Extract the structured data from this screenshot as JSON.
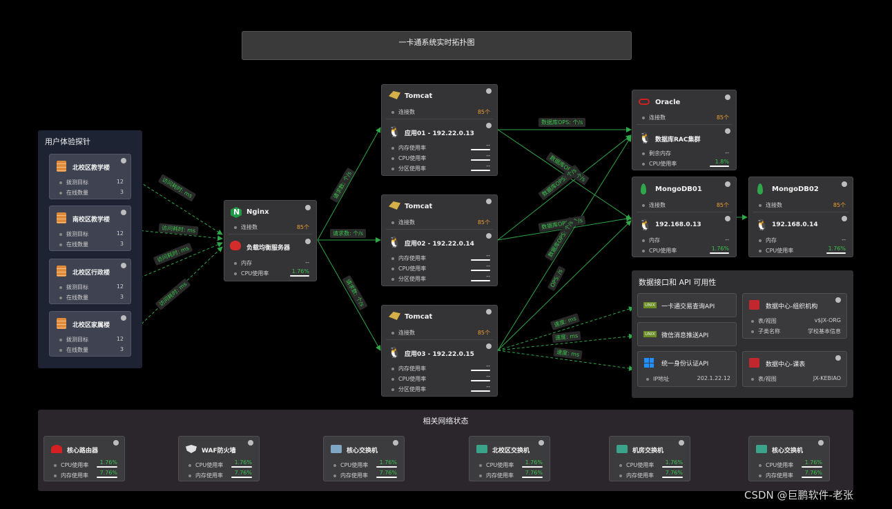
{
  "title": "一卡通系统实时拓扑图",
  "probe": {
    "heading": "用户体验探针",
    "items": [
      {
        "name": "北校区教学楼",
        "k1": "拨测目标",
        "v1": "12",
        "k2": "在线数量",
        "v2": "3"
      },
      {
        "name": "南校区教学楼",
        "k1": "拨测目标",
        "v1": "12",
        "k2": "在线数量",
        "v2": "3"
      },
      {
        "name": "北校区行政楼",
        "k1": "拨测目标",
        "v1": "12",
        "k2": "在线数量",
        "v2": "3"
      },
      {
        "name": "北校区家属楼",
        "k1": "拨测目标",
        "v1": "12",
        "k2": "在线数量",
        "v2": "3"
      }
    ],
    "edge_label": "访问耗时: ms"
  },
  "nginx": {
    "name": "Nginx",
    "conn_label": "连接数",
    "conn": "85个",
    "lb": "负载均衡服务器",
    "mem": "内存",
    "mem_val": "--",
    "cpu": "CPU使用率",
    "cpu_val": "1.76%"
  },
  "tomcats": [
    {
      "name": "Tomcat",
      "conn_label": "连接数",
      "conn": "85个",
      "app": "应用01 - 192.22.0.13",
      "r1": "内存使用率",
      "r2": "CPU使用率",
      "r3": "分区使用率",
      "v": "--"
    },
    {
      "name": "Tomcat",
      "conn_label": "连接数",
      "conn": "85个",
      "app": "应用02 - 192.22.0.14",
      "r1": "内存使用率",
      "r2": "CPU使用率",
      "r3": "分区使用率",
      "v": "--"
    },
    {
      "name": "Tomcat",
      "conn_label": "连接数",
      "conn": "85个",
      "app": "应用03 - 192.22.0.15",
      "r1": "内存使用率",
      "r2": "CPU使用率",
      "r3": "分区使用率",
      "v": "--"
    }
  ],
  "req_label": "请求数: 个/s",
  "db_label": "数据库OPS: 个/s",
  "ops_label": "OPS: /s",
  "speed_label": "速度: ms",
  "oracle": {
    "name": "Oracle",
    "conn_label": "连接数",
    "conn": "85个",
    "rac": "数据库RAC集群",
    "r1": "剩余内存",
    "v1": "--",
    "r2": "CPU使用率",
    "v2": "1.8%"
  },
  "mongo1": {
    "name": "MongoDB01",
    "conn_label": "连接数",
    "conn": "85个",
    "ip": "192.168.0.13",
    "r1": "内存",
    "v1": "--",
    "r2": "CPU使用率",
    "v2": "1.76%"
  },
  "mongo2": {
    "name": "MongoDB02",
    "conn_label": "连接数",
    "conn": "85个",
    "ip": "192.168.0.14",
    "r1": "内存",
    "v1": "--",
    "r2": "CPU使用率",
    "v2": "1.76%"
  },
  "api": {
    "heading": "数据接口和 API 可用性",
    "a1": "一卡通交易查询API",
    "a2": "微信消息推送API",
    "a3": "统一身份认证API",
    "a3k": "IP地址",
    "a3v": "202.1.22.12",
    "d1": "数据中心-组织机构",
    "d1k1": "表/视图",
    "d1v1": "v$JX-ORG",
    "d1k2": "子类名称",
    "d1v2": "学校基本信息",
    "d2": "数据中心-课表",
    "d2k1": "表/视图",
    "d2v1": "JX-KEBIAO",
    "unix": "UNIX"
  },
  "network": {
    "heading": "相关网络状态",
    "items": [
      {
        "name": "核心路由器",
        "k1": "CPU使用率",
        "v1": "1.76%",
        "k2": "内存使用率",
        "v2": "7.76%"
      },
      {
        "name": "WAF防火墙",
        "k1": "CPU使用率",
        "v1": "1.76%",
        "k2": "内存使用率",
        "v2": "7.76%"
      },
      {
        "name": "核心交换机",
        "k1": "CPU使用率",
        "v1": "1.76%",
        "k2": "内存使用率",
        "v2": "7.76%"
      },
      {
        "name": "北校区交换机",
        "k1": "CPU使用率",
        "v1": "1.76%",
        "k2": "内存使用率",
        "v2": "7.76%"
      },
      {
        "name": "机房交换机",
        "k1": "CPU使用率",
        "v1": "1.76%",
        "k2": "内存使用率",
        "v2": "7.76%"
      },
      {
        "name": "核心交换机",
        "k1": "CPU使用率",
        "v1": "1.76%",
        "k2": "内存使用率",
        "v2": "7.76%"
      }
    ]
  },
  "watermark": "CSDN @巨鹏软件-老张",
  "colors": {
    "accent": "#3ac24e",
    "orange": "#f0a030",
    "bg": "#000000"
  }
}
